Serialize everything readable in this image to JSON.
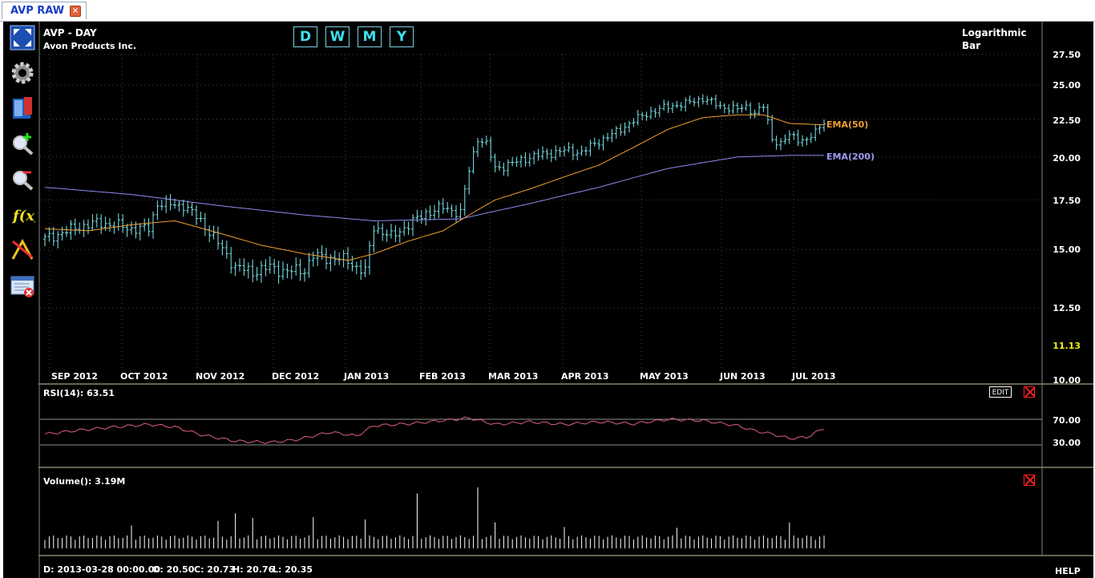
{
  "tab": {
    "label": "AVP RAW",
    "close": "×"
  },
  "header": {
    "symbol": "AVP - DAY",
    "company": "Avon Products Inc.",
    "scale": "Logarithmic",
    "style": "Bar"
  },
  "periods": [
    "D",
    "W",
    "M",
    "Y"
  ],
  "toolbar": [
    "fullscreen-icon",
    "gear-icon",
    "book-icon",
    "zoom-in-icon",
    "zoom-out-icon",
    "function-icon",
    "drawing-tools-icon",
    "remove-indicator-icon"
  ],
  "colors": {
    "price": "#7fe8f0",
    "ema50": "#f0a030",
    "ema200": "#8c8cf0",
    "rsi": "#e0607a",
    "volume": "#ffffff",
    "last_price": "#f0f020"
  },
  "status": {
    "date": "D: 2013-03-28 00:00.00",
    "open": "O: 20.50",
    "close": "C: 20.73",
    "high": "H: 20.76",
    "low": "L: 20.35",
    "help": "HELP"
  },
  "chart_data": [
    {
      "type": "bar",
      "scale": "log",
      "ylim": [
        10.0,
        27.5
      ],
      "yticks": [
        "27.50",
        "25.00",
        "22.50",
        "20.00",
        "17.50",
        "15.00",
        "12.50",
        "10.00"
      ],
      "last_price": "11.13",
      "x_labels": [
        "SEP 2012",
        "OCT 2012",
        "NOV 2012",
        "DEC 2012",
        "JAN 2013",
        "FEB 2013",
        "MAR 2013",
        "APR 2013",
        "MAY 2013",
        "JUN 2013",
        "JUL 2013"
      ],
      "price_anchors": [
        [
          0,
          15.5
        ],
        [
          8,
          16.1
        ],
        [
          12,
          16.3
        ],
        [
          16,
          16.2
        ],
        [
          20,
          16.0
        ],
        [
          24,
          16.0
        ],
        [
          26,
          17.3
        ],
        [
          32,
          17.2
        ],
        [
          36,
          16.4
        ],
        [
          40,
          15.3
        ],
        [
          44,
          14.2
        ],
        [
          48,
          14.0
        ],
        [
          52,
          14.2
        ],
        [
          56,
          14.0
        ],
        [
          60,
          14.1
        ],
        [
          62,
          14.7
        ],
        [
          66,
          14.6
        ],
        [
          70,
          14.5
        ],
        [
          72,
          14.2
        ],
        [
          74,
          14.0
        ],
        [
          76,
          16.1
        ],
        [
          80,
          15.6
        ],
        [
          84,
          16.2
        ],
        [
          88,
          16.8
        ],
        [
          92,
          17.1
        ],
        [
          96,
          16.8
        ],
        [
          98,
          19.2
        ],
        [
          100,
          21.2
        ],
        [
          102,
          20.8
        ],
        [
          104,
          19.3
        ],
        [
          108,
          19.6
        ],
        [
          112,
          20.0
        ],
        [
          116,
          20.2
        ],
        [
          120,
          20.4
        ],
        [
          124,
          20.3
        ],
        [
          128,
          21.0
        ],
        [
          132,
          21.6
        ],
        [
          136,
          22.4
        ],
        [
          140,
          23.0
        ],
        [
          144,
          23.4
        ],
        [
          148,
          23.6
        ],
        [
          152,
          24.0
        ],
        [
          156,
          23.4
        ],
        [
          160,
          23.2
        ],
        [
          162,
          23.4
        ],
        [
          164,
          22.9
        ],
        [
          166,
          23.4
        ],
        [
          168,
          21.2
        ],
        [
          170,
          20.8
        ],
        [
          172,
          21.4
        ],
        [
          174,
          21.2
        ],
        [
          176,
          21.0
        ],
        [
          178,
          21.6
        ],
        [
          180,
          22.4
        ]
      ],
      "ema50_anchors": [
        [
          0,
          16.0
        ],
        [
          10,
          15.9
        ],
        [
          20,
          16.2
        ],
        [
          30,
          16.4
        ],
        [
          40,
          15.8
        ],
        [
          50,
          15.2
        ],
        [
          60,
          14.8
        ],
        [
          70,
          14.5
        ],
        [
          76,
          14.8
        ],
        [
          84,
          15.4
        ],
        [
          92,
          15.9
        ],
        [
          98,
          16.7
        ],
        [
          104,
          17.5
        ],
        [
          112,
          18.1
        ],
        [
          120,
          18.8
        ],
        [
          128,
          19.5
        ],
        [
          136,
          20.6
        ],
        [
          144,
          21.8
        ],
        [
          152,
          22.6
        ],
        [
          160,
          22.8
        ],
        [
          166,
          22.8
        ],
        [
          172,
          22.2
        ],
        [
          180,
          22.1
        ]
      ],
      "ema200_anchors": [
        [
          0,
          18.2
        ],
        [
          20,
          17.8
        ],
        [
          40,
          17.2
        ],
        [
          60,
          16.7
        ],
        [
          76,
          16.4
        ],
        [
          96,
          16.5
        ],
        [
          112,
          17.3
        ],
        [
          128,
          18.2
        ],
        [
          144,
          19.3
        ],
        [
          160,
          20.0
        ],
        [
          172,
          20.1
        ],
        [
          180,
          20.1
        ]
      ],
      "series": [
        {
          "name": "EMA(50)"
        },
        {
          "name": "EMA(200)"
        }
      ]
    },
    {
      "type": "line",
      "title": "RSI(14): 63.51",
      "ylim": [
        0,
        100
      ],
      "reference_lines": [
        70,
        30
      ],
      "tick_labels": [
        "70.00",
        "30.00"
      ],
      "edit_label": "EDIT",
      "anchors": [
        [
          0,
          47
        ],
        [
          8,
          53
        ],
        [
          16,
          58
        ],
        [
          24,
          62
        ],
        [
          30,
          58
        ],
        [
          36,
          46
        ],
        [
          44,
          36
        ],
        [
          52,
          34
        ],
        [
          58,
          38
        ],
        [
          66,
          50
        ],
        [
          72,
          44
        ],
        [
          76,
          60
        ],
        [
          84,
          63
        ],
        [
          92,
          68
        ],
        [
          98,
          72
        ],
        [
          104,
          62
        ],
        [
          112,
          66
        ],
        [
          120,
          62
        ],
        [
          128,
          66
        ],
        [
          136,
          63
        ],
        [
          144,
          70
        ],
        [
          152,
          68
        ],
        [
          160,
          60
        ],
        [
          164,
          52
        ],
        [
          168,
          47
        ],
        [
          172,
          40
        ],
        [
          176,
          42
        ],
        [
          180,
          56
        ]
      ]
    },
    {
      "type": "bar",
      "title": "Volume(): 3.19M",
      "spikes": [
        [
          20,
          3.0
        ],
        [
          40,
          3.6
        ],
        [
          44,
          4.6
        ],
        [
          48,
          4.0
        ],
        [
          62,
          4.1
        ],
        [
          74,
          3.8
        ],
        [
          86,
          7.2
        ],
        [
          100,
          8.0
        ],
        [
          104,
          3.4
        ],
        [
          120,
          2.8
        ],
        [
          146,
          2.7
        ],
        [
          172,
          3.4
        ]
      ]
    }
  ]
}
